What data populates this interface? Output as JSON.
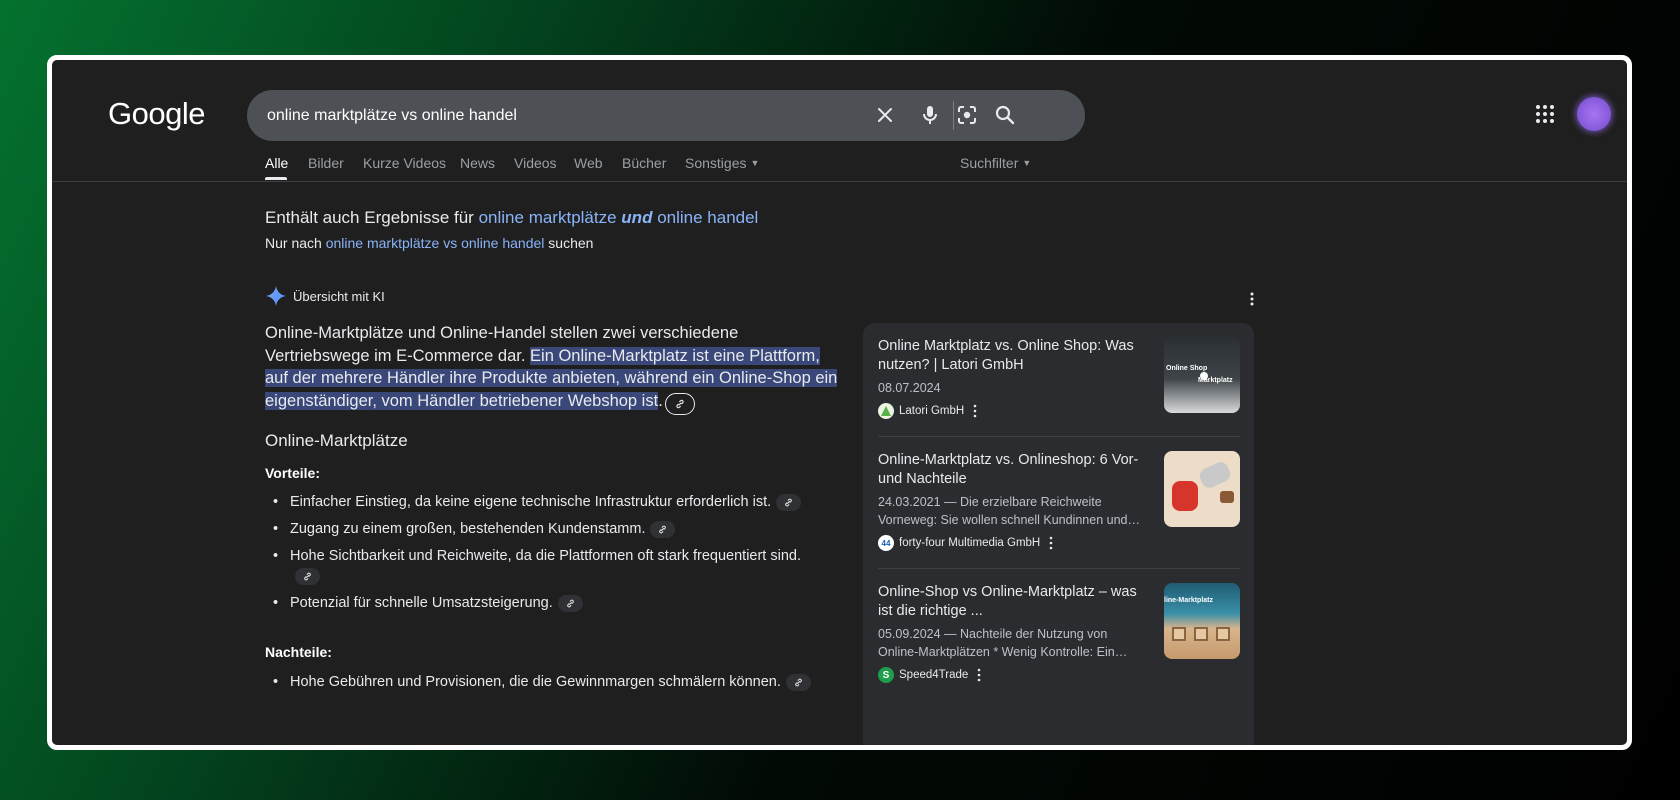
{
  "logo": "Google",
  "search": {
    "value": "online marktplätze vs online handel"
  },
  "tabs": [
    {
      "label": "Alle"
    },
    {
      "label": "Bilder"
    },
    {
      "label": "Kurze Videos"
    },
    {
      "label": "News"
    },
    {
      "label": "Videos"
    },
    {
      "label": "Web"
    },
    {
      "label": "Bücher"
    },
    {
      "label": "Sonstiges"
    }
  ],
  "filter": "Suchfilter",
  "spelling": {
    "prefix": "Enthält auch Ergebnisse für",
    "suggest_a": "online marktplätze",
    "suggest_b": "und",
    "suggest_c": "online handel",
    "only_prefix": "Nur nach",
    "only_query": "online marktplätze vs online handel",
    "only_suffix": "suchen"
  },
  "ai": {
    "heading": "Übersicht mit KI",
    "intro": "Online-Marktplätze und Online-Handel stellen zwei verschiedene Vertriebswege im E-Commerce dar.",
    "highlight": "Ein Online-Marktplatz ist eine Plattform, auf der mehrere Händler ihre Produkte anbieten, während ein Online-Shop ein eigenständiger, vom Händler betriebener Webshop ist",
    "section": "Online-Marktplätze",
    "pros_label": "Vorteile:",
    "pros": [
      "Einfacher Einstieg, da keine eigene technische Infrastruktur erforderlich ist.",
      "Zugang zu einem großen, bestehenden Kundenstamm.",
      "Hohe Sichtbarkeit und Reichweite, da die Plattformen oft stark frequentiert sind.",
      "Potenzial für schnelle Umsatzsteigerung."
    ],
    "cons_label": "Nachteile:",
    "cons": [
      "Hohe Gebühren und Provisionen, die die Gewinnmargen schmälern können."
    ]
  },
  "sources": [
    {
      "title": "Online Marktplatz vs. Online Shop: Was nutzen? | Latori GmbH",
      "date": "08.07.2024",
      "site": "Latori GmbH",
      "thumb_text_a": "Online Shop",
      "thumb_text_b": "Marktplatz"
    },
    {
      "title": "Online-Marktplatz vs. Onlineshop: 6 Vor- und Nachteile",
      "date": "24.03.2021 — Die erzielbare Reichweite Vorneweg: Sie wollen schnell Kundinnen und…",
      "site": "forty-four Multimedia GmbH"
    },
    {
      "title": "Online-Shop vs Online-Marktplatz – was ist die richtige ...",
      "date": "05.09.2024 — Nachteile der Nutzung von Online-Marktplätzen * Wenig Kontrolle: Ein…",
      "site": "Speed4Trade",
      "thumb_text_a": "line-Marktplatz"
    }
  ]
}
